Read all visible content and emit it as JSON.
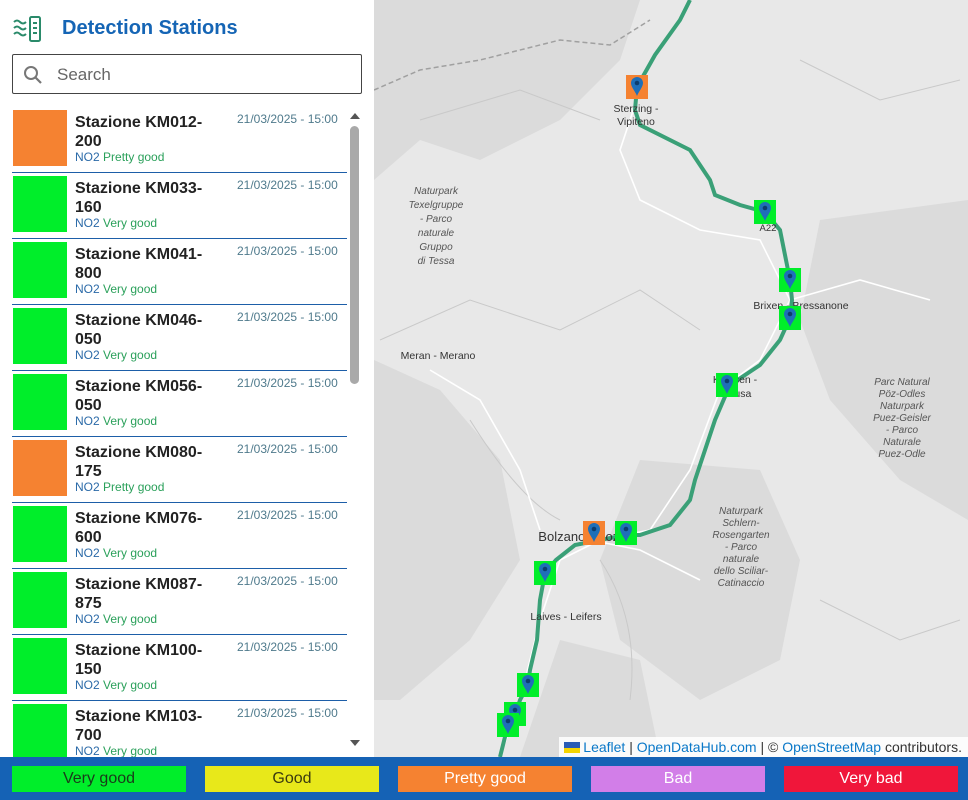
{
  "header": {
    "title": "Detection Stations",
    "logo_icon": "air-sensor-icon"
  },
  "search": {
    "placeholder": "Search",
    "icon": "search-icon"
  },
  "stations": [
    {
      "name": "Stazione KM012-200",
      "time": "21/03/2025 - 15:00",
      "pollutant": "NO2",
      "quality": "Pretty good",
      "color": "#f58231"
    },
    {
      "name": "Stazione KM033-160",
      "time": "21/03/2025 - 15:00",
      "pollutant": "NO2",
      "quality": "Very good",
      "color": "#00ee2a"
    },
    {
      "name": "Stazione KM041-800",
      "time": "21/03/2025 - 15:00",
      "pollutant": "NO2",
      "quality": "Very good",
      "color": "#00ee2a"
    },
    {
      "name": "Stazione KM046-050",
      "time": "21/03/2025 - 15:00",
      "pollutant": "NO2",
      "quality": "Very good",
      "color": "#00ee2a"
    },
    {
      "name": "Stazione KM056-050",
      "time": "21/03/2025 - 15:00",
      "pollutant": "NO2",
      "quality": "Very good",
      "color": "#00ee2a"
    },
    {
      "name": "Stazione KM080-175",
      "time": "21/03/2025 - 15:00",
      "pollutant": "NO2",
      "quality": "Pretty good",
      "color": "#f58231"
    },
    {
      "name": "Stazione KM076-600",
      "time": "21/03/2025 - 15:00",
      "pollutant": "NO2",
      "quality": "Very good",
      "color": "#00ee2a"
    },
    {
      "name": "Stazione KM087-875",
      "time": "21/03/2025 - 15:00",
      "pollutant": "NO2",
      "quality": "Very good",
      "color": "#00ee2a"
    },
    {
      "name": "Stazione KM100-150",
      "time": "21/03/2025 - 15:00",
      "pollutant": "NO2",
      "quality": "Very good",
      "color": "#00ee2a"
    },
    {
      "name": "Stazione KM103-700",
      "time": "21/03/2025 - 15:00",
      "pollutant": "NO2",
      "quality": "Very good",
      "color": "#00ee2a"
    }
  ],
  "map": {
    "place_labels": [
      "Sterzing - Vipiteno",
      "Naturpark Texelgruppe - Parco naturale Gruppo di Tessa",
      "A22",
      "Brixen - Bressanone",
      "Meran - Merano",
      "Klausen - Chiusa",
      "Parc Natural Pöz-Odles Naturpark Puez-Geisler - Parco Naturale Puez-Odle",
      "Naturpark Schlern-Rosengarten - Parco naturale dello Sciliar-Catinaccio",
      "Bolzano - Bozen",
      "Leifers - Laives"
    ],
    "route_color": "#3aa077",
    "marker_icon": "map-pin-icon"
  },
  "attribution": {
    "leaflet": "Leaflet",
    "sep1": " | ",
    "odh": "OpenDataHub.com",
    "sep2": " | © ",
    "osm": "OpenStreetMap",
    "tail": " contributors."
  },
  "legend": [
    {
      "label": "Very good",
      "color": "#00ee2a",
      "text_color": "#1a3a1a"
    },
    {
      "label": "Good",
      "color": "#e8e81a",
      "text_color": "#3a3a10"
    },
    {
      "label": "Pretty good",
      "color": "#f58231",
      "text_color": "#ffffff"
    },
    {
      "label": "Bad",
      "color": "#d27ee8",
      "text_color": "#ffffff"
    },
    {
      "label": "Very bad",
      "color": "#f0163a",
      "text_color": "#ffffff"
    }
  ]
}
